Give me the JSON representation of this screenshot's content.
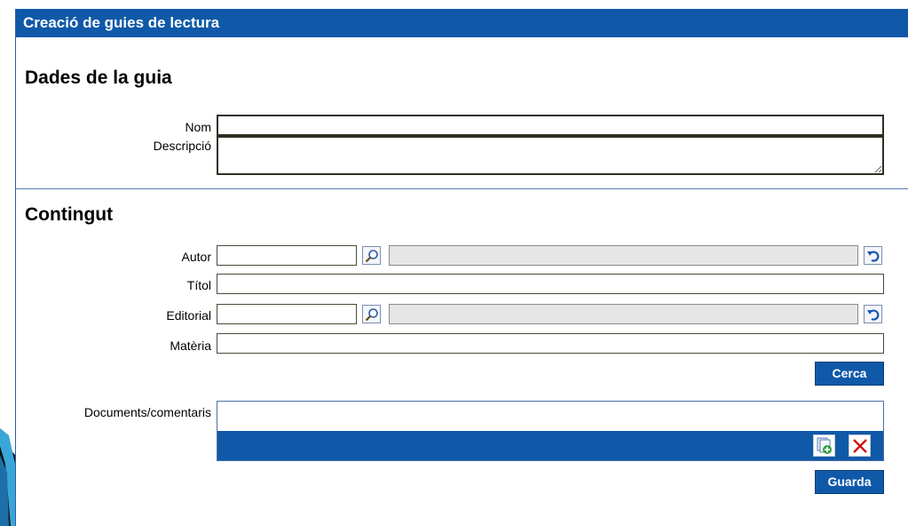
{
  "window": {
    "title": "Creació de guies de lectura"
  },
  "guide_data": {
    "heading": "Dades de la guia",
    "name_label": "Nom",
    "name_value": "",
    "description_label": "Descripció",
    "description_value": ""
  },
  "content": {
    "heading": "Contingut",
    "author_label": "Autor",
    "author_code": "",
    "author_name": "",
    "title_label": "Títol",
    "title_value": "",
    "publisher_label": "Editorial",
    "publisher_code": "",
    "publisher_name": "",
    "subject_label": "Matèria",
    "subject_value": "",
    "search_button": "Cerca",
    "documents_label": "Documents/comentaris",
    "save_button": "Guarda"
  },
  "icons": {
    "lookup": "magnifier-icon",
    "reset": "undo-arrow-icon",
    "add_document": "add-document-icon",
    "delete": "delete-x-icon"
  },
  "colors": {
    "accent": "#1059a8",
    "delete_red": "#d01010",
    "add_green": "#2fa03a"
  }
}
